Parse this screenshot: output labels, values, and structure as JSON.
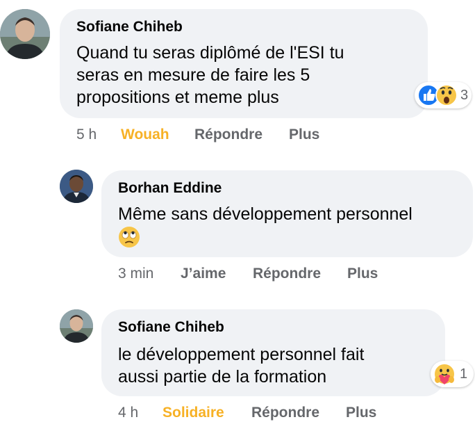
{
  "comments": [
    {
      "author": "Sofiane Chiheb",
      "text_lines": [
        "Quand tu seras diplômé de l'ESI tu",
        "seras en mesure de faire les 5",
        "propositions et meme plus"
      ],
      "time": "5 h",
      "reaction_label": "Wouah",
      "reply_label": "Répondre",
      "more_label": "Plus",
      "reaction_icons": [
        "like-icon",
        "wow-icon"
      ],
      "reaction_count": "3"
    },
    {
      "author": "Borhan Eddine",
      "text_lines": [
        "Même sans développement personnel"
      ],
      "text_emoji": "eye-roll-emoji-icon",
      "time": "3 min",
      "reaction_label": "J’aime",
      "reply_label": "Répondre",
      "more_label": "Plus"
    },
    {
      "author": "Sofiane Chiheb",
      "text_lines": [
        "le développement personnel fait",
        "aussi partie de la formation"
      ],
      "time": "4 h",
      "reaction_label": "Solidaire",
      "reply_label": "Répondre",
      "more_label": "Plus",
      "reaction_icons": [
        "care-icon"
      ],
      "reaction_count": "1"
    }
  ],
  "colors": {
    "bubble": "#f0f2f5",
    "meta_text": "#65676b",
    "reaction_active": "#f7b125",
    "like_blue": "#1877f2",
    "emoji_yellow": "#f7c548"
  }
}
